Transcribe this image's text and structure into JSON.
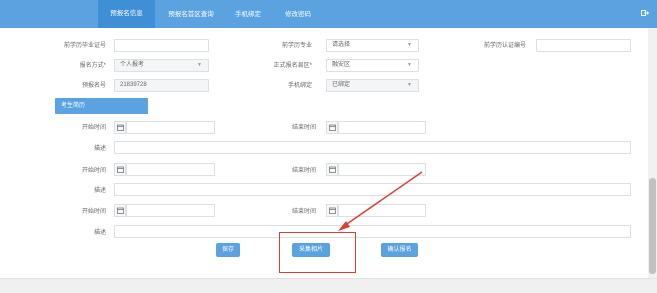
{
  "nav": {
    "tabs": [
      "预报名信息",
      "预报名首区查询",
      "手机绑定",
      "修改密码"
    ],
    "active_tab": "预报名信息",
    "exit_icon": "exit-icon"
  },
  "form": {
    "prev_cert_label": "前学历毕业证号",
    "prev_major_label": "前学历专业",
    "prev_major_value": "请选择",
    "prev_cert_verify_label": "前学历认证编号",
    "signup_mode_label": "报名方式*",
    "signup_mode_value": "个人报考",
    "formal_area_label": "正式报名县区*",
    "formal_area_value": "融安区",
    "prereg_no_label": "预报名号",
    "prereg_no_value": "21839728",
    "phone_bind_label": "手机绑定",
    "phone_bind_value": "已绑定"
  },
  "resume": {
    "section_title": "考生简历",
    "start_label": "开始时间",
    "end_label": "结束时间",
    "desc_label": "描述"
  },
  "buttons": {
    "save": "保存",
    "photo": "采集相片",
    "confirm": "确认报名"
  },
  "colors": {
    "accent": "#5aa2e0",
    "annotation": "#e03c32"
  }
}
